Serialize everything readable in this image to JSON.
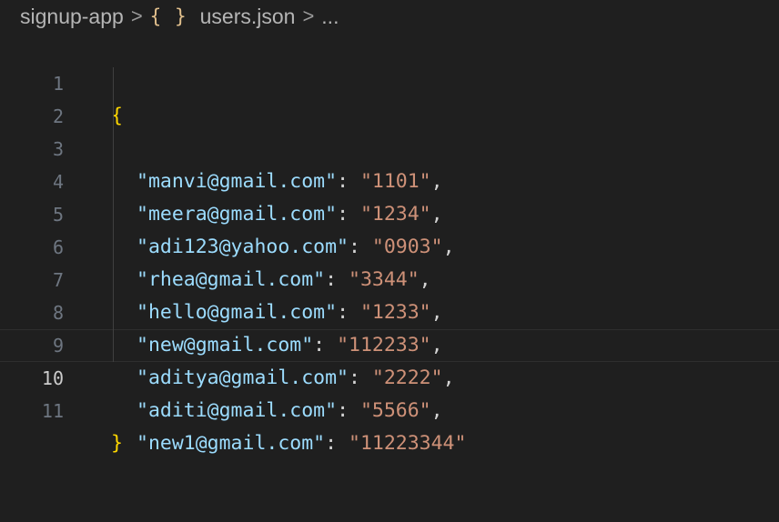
{
  "breadcrumb": {
    "folder": "signup-app",
    "separator": ">",
    "file_icon": "{ }",
    "file": "users.json",
    "more": "..."
  },
  "editor": {
    "current_line": 10,
    "line_numbers": [
      "1",
      "2",
      "3",
      "4",
      "5",
      "6",
      "7",
      "8",
      "9",
      "10",
      "11"
    ],
    "open_brace": "{",
    "close_brace": "}",
    "entries": [
      {
        "key": "\"manvi@gmail.com\"",
        "value": "\"1101\"",
        "trail": ","
      },
      {
        "key": "\"meera@gmail.com\"",
        "value": "\"1234\"",
        "trail": ","
      },
      {
        "key": "\"adi123@yahoo.com\"",
        "value": "\"0903\"",
        "trail": ","
      },
      {
        "key": "\"rhea@gmail.com\"",
        "value": "\"3344\"",
        "trail": ","
      },
      {
        "key": "\"hello@gmail.com\"",
        "value": "\"1233\"",
        "trail": ","
      },
      {
        "key": "\"new@gmail.com\"",
        "value": "\"112233\"",
        "trail": ","
      },
      {
        "key": "\"aditya@gmail.com\"",
        "value": "\"2222\"",
        "trail": ","
      },
      {
        "key": "\"aditi@gmail.com\"",
        "value": "\"5566\"",
        "trail": ","
      },
      {
        "key": "\"new1@gmail.com\"",
        "value": "\"11223344\"",
        "trail": ""
      }
    ],
    "colon": ": "
  },
  "colors": {
    "background": "#1f1f1f",
    "brace": "#ffd700",
    "key": "#9cdcfe",
    "string": "#ce9178",
    "line_number": "#6e7681",
    "line_number_active": "#cccccc"
  }
}
